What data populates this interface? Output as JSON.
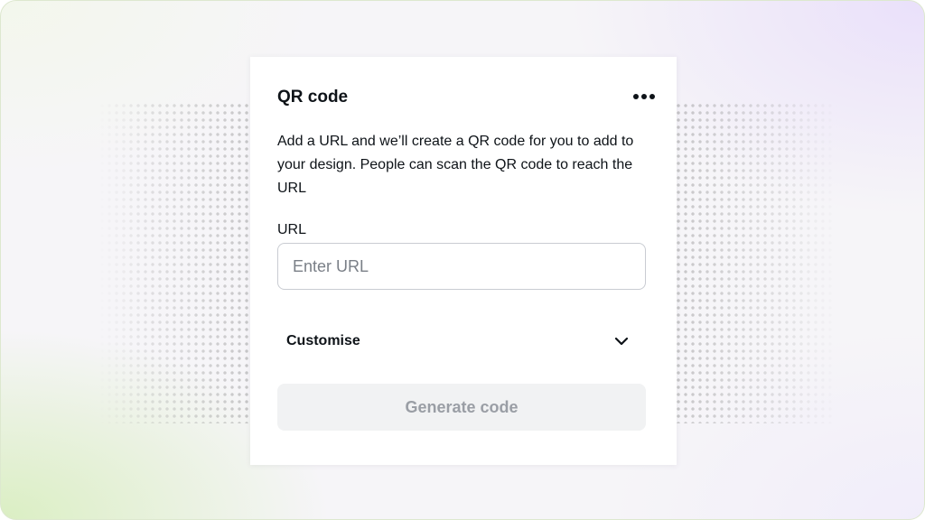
{
  "panel": {
    "title": "QR code",
    "more_icon": "more-horizontal-icon",
    "description": "Add a URL and we’ll create a QR code for you to add to your design. People can scan the QR code to reach the URL",
    "url_label": "URL",
    "url_input": {
      "placeholder": "Enter URL",
      "value": ""
    },
    "customise": {
      "label": "Customise",
      "icon": "chevron-down-icon",
      "expanded": false
    },
    "generate_button": {
      "label": "Generate code",
      "disabled": true
    }
  },
  "colors": {
    "text": "#0e1318",
    "panel_background": "#ffffff",
    "input_border": "#c9ccd2",
    "button_disabled_background": "#f1f2f3",
    "button_disabled_text": "#9a9ea5",
    "background_green_tint": "#d9eec0",
    "background_purple_tint": "#e9dffa"
  }
}
